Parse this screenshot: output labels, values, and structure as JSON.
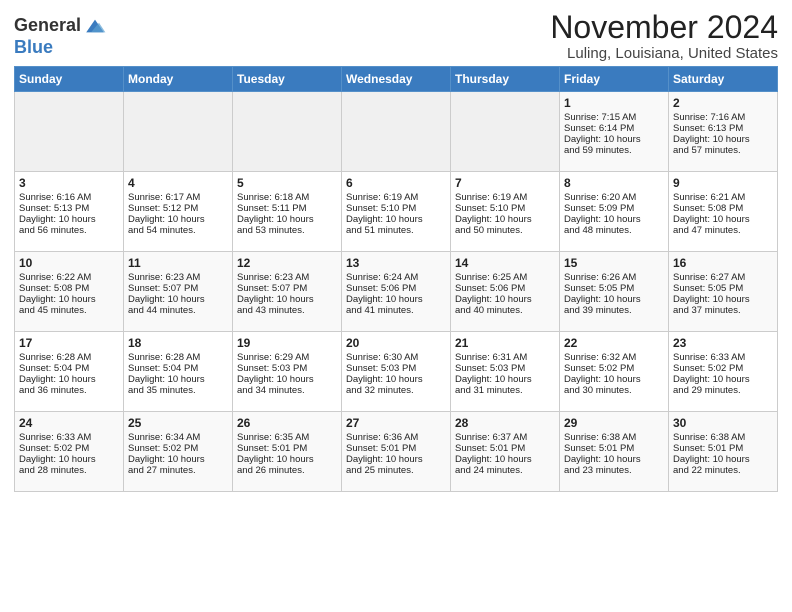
{
  "header": {
    "logo_line1": "General",
    "logo_line2": "Blue",
    "month_title": "November 2024",
    "location": "Luling, Louisiana, United States"
  },
  "weekdays": [
    "Sunday",
    "Monday",
    "Tuesday",
    "Wednesday",
    "Thursday",
    "Friday",
    "Saturday"
  ],
  "weeks": [
    [
      {
        "day": "",
        "info": ""
      },
      {
        "day": "",
        "info": ""
      },
      {
        "day": "",
        "info": ""
      },
      {
        "day": "",
        "info": ""
      },
      {
        "day": "",
        "info": ""
      },
      {
        "day": "1",
        "info": "Sunrise: 7:15 AM\nSunset: 6:14 PM\nDaylight: 10 hours\nand 59 minutes."
      },
      {
        "day": "2",
        "info": "Sunrise: 7:16 AM\nSunset: 6:13 PM\nDaylight: 10 hours\nand 57 minutes."
      }
    ],
    [
      {
        "day": "3",
        "info": "Sunrise: 6:16 AM\nSunset: 5:13 PM\nDaylight: 10 hours\nand 56 minutes."
      },
      {
        "day": "4",
        "info": "Sunrise: 6:17 AM\nSunset: 5:12 PM\nDaylight: 10 hours\nand 54 minutes."
      },
      {
        "day": "5",
        "info": "Sunrise: 6:18 AM\nSunset: 5:11 PM\nDaylight: 10 hours\nand 53 minutes."
      },
      {
        "day": "6",
        "info": "Sunrise: 6:19 AM\nSunset: 5:10 PM\nDaylight: 10 hours\nand 51 minutes."
      },
      {
        "day": "7",
        "info": "Sunrise: 6:19 AM\nSunset: 5:10 PM\nDaylight: 10 hours\nand 50 minutes."
      },
      {
        "day": "8",
        "info": "Sunrise: 6:20 AM\nSunset: 5:09 PM\nDaylight: 10 hours\nand 48 minutes."
      },
      {
        "day": "9",
        "info": "Sunrise: 6:21 AM\nSunset: 5:08 PM\nDaylight: 10 hours\nand 47 minutes."
      }
    ],
    [
      {
        "day": "10",
        "info": "Sunrise: 6:22 AM\nSunset: 5:08 PM\nDaylight: 10 hours\nand 45 minutes."
      },
      {
        "day": "11",
        "info": "Sunrise: 6:23 AM\nSunset: 5:07 PM\nDaylight: 10 hours\nand 44 minutes."
      },
      {
        "day": "12",
        "info": "Sunrise: 6:23 AM\nSunset: 5:07 PM\nDaylight: 10 hours\nand 43 minutes."
      },
      {
        "day": "13",
        "info": "Sunrise: 6:24 AM\nSunset: 5:06 PM\nDaylight: 10 hours\nand 41 minutes."
      },
      {
        "day": "14",
        "info": "Sunrise: 6:25 AM\nSunset: 5:06 PM\nDaylight: 10 hours\nand 40 minutes."
      },
      {
        "day": "15",
        "info": "Sunrise: 6:26 AM\nSunset: 5:05 PM\nDaylight: 10 hours\nand 39 minutes."
      },
      {
        "day": "16",
        "info": "Sunrise: 6:27 AM\nSunset: 5:05 PM\nDaylight: 10 hours\nand 37 minutes."
      }
    ],
    [
      {
        "day": "17",
        "info": "Sunrise: 6:28 AM\nSunset: 5:04 PM\nDaylight: 10 hours\nand 36 minutes."
      },
      {
        "day": "18",
        "info": "Sunrise: 6:28 AM\nSunset: 5:04 PM\nDaylight: 10 hours\nand 35 minutes."
      },
      {
        "day": "19",
        "info": "Sunrise: 6:29 AM\nSunset: 5:03 PM\nDaylight: 10 hours\nand 34 minutes."
      },
      {
        "day": "20",
        "info": "Sunrise: 6:30 AM\nSunset: 5:03 PM\nDaylight: 10 hours\nand 32 minutes."
      },
      {
        "day": "21",
        "info": "Sunrise: 6:31 AM\nSunset: 5:03 PM\nDaylight: 10 hours\nand 31 minutes."
      },
      {
        "day": "22",
        "info": "Sunrise: 6:32 AM\nSunset: 5:02 PM\nDaylight: 10 hours\nand 30 minutes."
      },
      {
        "day": "23",
        "info": "Sunrise: 6:33 AM\nSunset: 5:02 PM\nDaylight: 10 hours\nand 29 minutes."
      }
    ],
    [
      {
        "day": "24",
        "info": "Sunrise: 6:33 AM\nSunset: 5:02 PM\nDaylight: 10 hours\nand 28 minutes."
      },
      {
        "day": "25",
        "info": "Sunrise: 6:34 AM\nSunset: 5:02 PM\nDaylight: 10 hours\nand 27 minutes."
      },
      {
        "day": "26",
        "info": "Sunrise: 6:35 AM\nSunset: 5:01 PM\nDaylight: 10 hours\nand 26 minutes."
      },
      {
        "day": "27",
        "info": "Sunrise: 6:36 AM\nSunset: 5:01 PM\nDaylight: 10 hours\nand 25 minutes."
      },
      {
        "day": "28",
        "info": "Sunrise: 6:37 AM\nSunset: 5:01 PM\nDaylight: 10 hours\nand 24 minutes."
      },
      {
        "day": "29",
        "info": "Sunrise: 6:38 AM\nSunset: 5:01 PM\nDaylight: 10 hours\nand 23 minutes."
      },
      {
        "day": "30",
        "info": "Sunrise: 6:38 AM\nSunset: 5:01 PM\nDaylight: 10 hours\nand 22 minutes."
      }
    ]
  ]
}
